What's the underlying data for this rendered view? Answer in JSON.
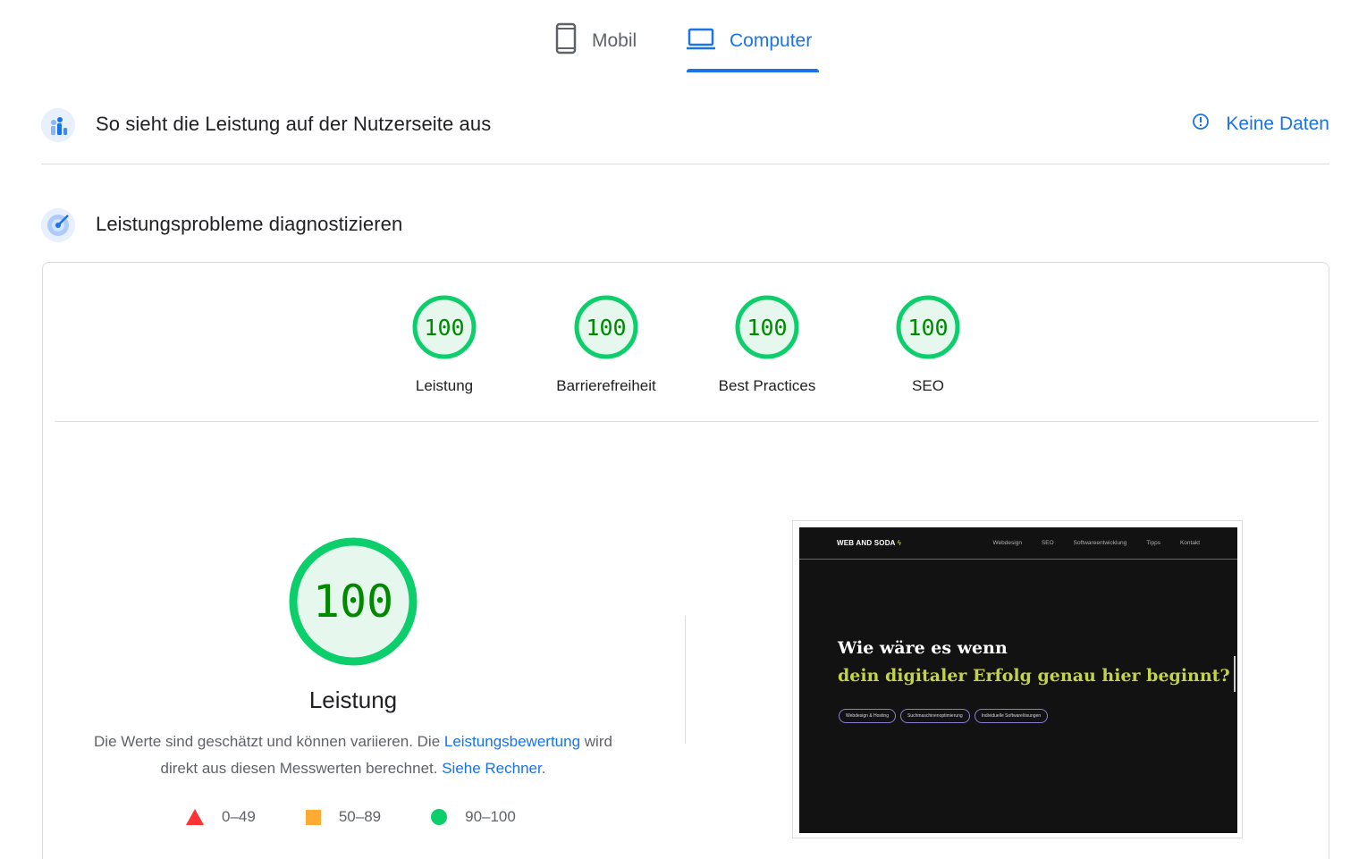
{
  "tabs": [
    {
      "label": "Mobil",
      "icon": "smartphone-icon",
      "active": false
    },
    {
      "label": "Computer",
      "icon": "laptop-icon",
      "active": true
    }
  ],
  "field_data": {
    "title": "So sieht die Leistung auf der Nutzerseite aus",
    "icon": "people-chart-icon",
    "status_label": "Keine Daten",
    "status_icon": "info-icon"
  },
  "diagnose": {
    "title": "Leistungsprobleme diagnostizieren",
    "icon": "lighthouse-icon"
  },
  "scores": [
    {
      "label": "Leistung",
      "value": "100"
    },
    {
      "label": "Barrierefreiheit",
      "value": "100"
    },
    {
      "label": "Best Practices",
      "value": "100"
    },
    {
      "label": "SEO",
      "value": "100"
    }
  ],
  "performance": {
    "score": "100",
    "label": "Leistung",
    "desc_part1": "Die Werte sind geschätzt und können variieren. Die ",
    "desc_link1": "Leistungsbewertung",
    "desc_part2": " wird direkt aus diesen Messwerten berechnet. ",
    "desc_link2": "Siehe Rechner",
    "desc_part3": "."
  },
  "legend": [
    {
      "range": "0–49",
      "color": "#ff3333",
      "shape": "triangle"
    },
    {
      "range": "50–89",
      "color": "#ffaa33",
      "shape": "square"
    },
    {
      "range": "90–100",
      "color": "#0cce6b",
      "shape": "circle"
    }
  ],
  "preview": {
    "logo": "WEB AND SODA",
    "menu": [
      "Webdesign",
      "SEO",
      "Softwareentwicklung",
      "Tipps",
      "Kontakt"
    ],
    "headline_1": "Wie wäre es wenn",
    "headline_2": "dein digitaler Erfolg genau hier beginnt?",
    "pills": [
      "Webdesign & Hosting",
      "Suchmaschinenoptimierung",
      "Individuelle Softwarelösungen"
    ]
  },
  "colors": {
    "accent": "#1a73e8",
    "pass_green": "#0cce6b",
    "pass_text": "#008800",
    "pass_fill": "#e6f8ee"
  }
}
